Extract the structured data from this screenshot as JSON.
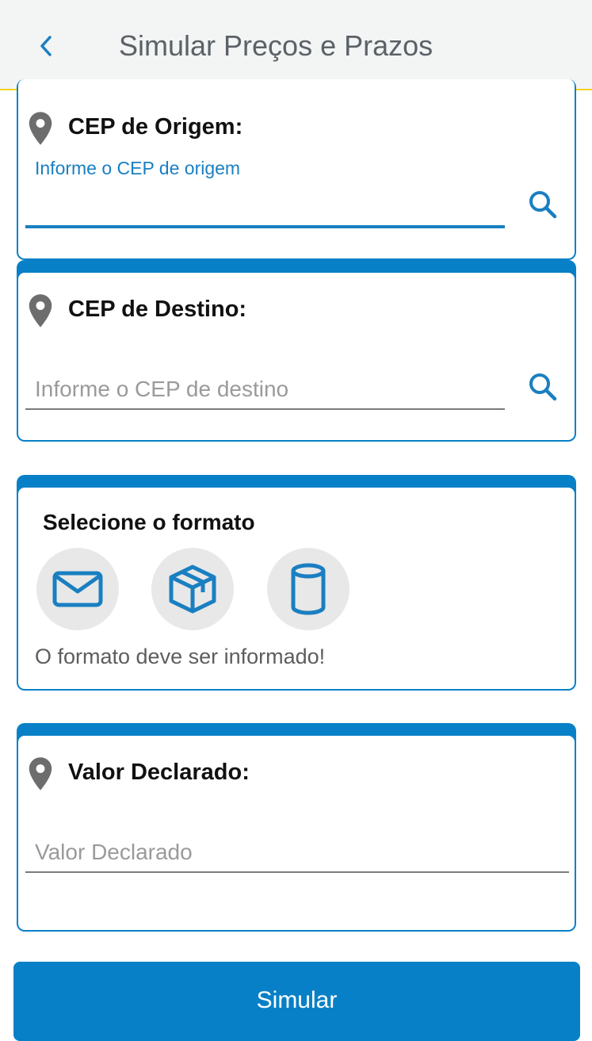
{
  "header": {
    "back_icon": "chevron-left-icon",
    "title": "Simular Preços e Prazos"
  },
  "origin": {
    "title": "CEP de Origem:",
    "label": "Informe o CEP de origem",
    "value": "",
    "icon": "location-pin-icon",
    "action_icon": "search-icon"
  },
  "destination": {
    "title": "CEP de Destino:",
    "placeholder": "Informe o CEP de destino",
    "icon": "location-pin-icon",
    "action_icon": "search-icon"
  },
  "format": {
    "title": "Selecione o formato",
    "options": [
      {
        "icon": "envelope-icon"
      },
      {
        "icon": "package-box-icon"
      },
      {
        "icon": "cylinder-icon"
      }
    ],
    "error": "O formato deve ser informado!"
  },
  "declared_value": {
    "title": "Valor Declarado:",
    "placeholder": "Valor Declarado",
    "icon": "location-pin-icon"
  },
  "submit": {
    "label": "Simular"
  },
  "colors": {
    "primary": "#0880c7",
    "accent_yellow": "#f2d31b",
    "header_bg": "#f3f4f4"
  }
}
